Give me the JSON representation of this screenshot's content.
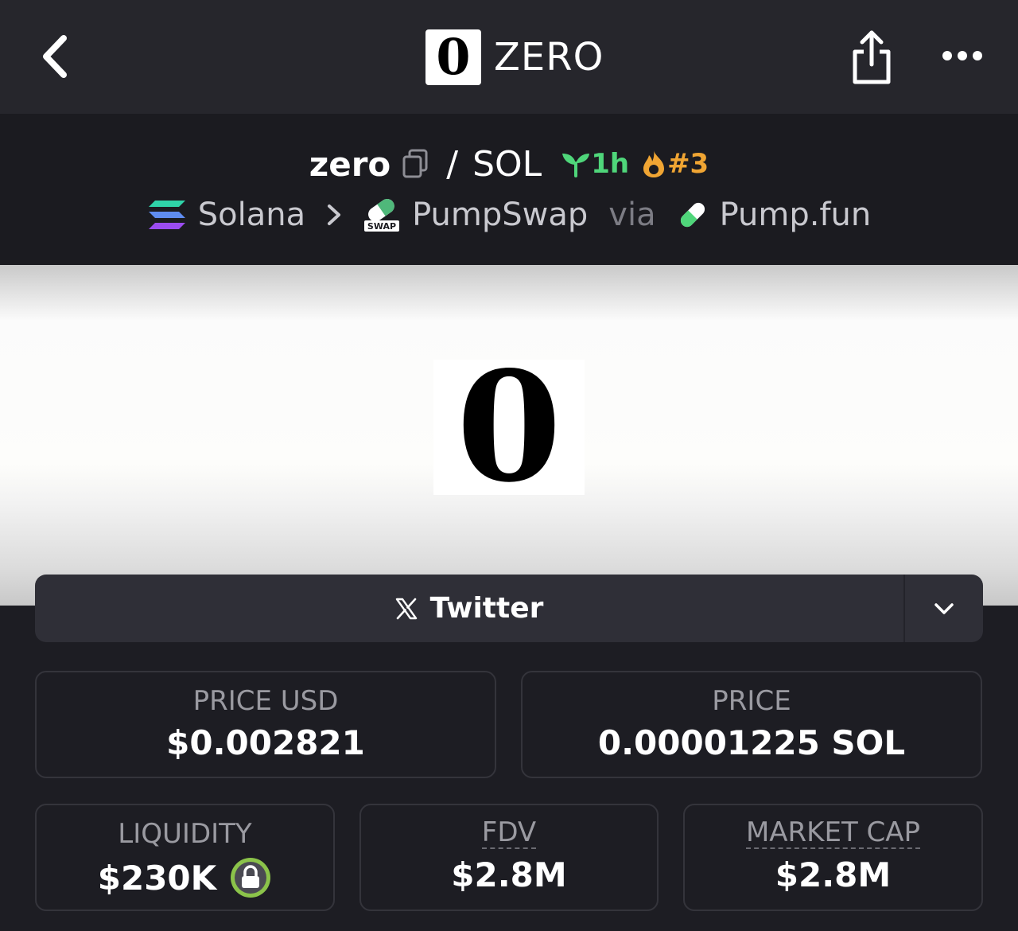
{
  "nav": {
    "logo_glyph": "0",
    "title": "ZERO"
  },
  "pair": {
    "base": "zero",
    "separator": "/",
    "quote": "SOL",
    "age": "1h",
    "rank": "#3"
  },
  "route": {
    "chain": "Solana",
    "dex": "PumpSwap",
    "via": "via",
    "launchpad": "Pump.fun",
    "dex_badge": "SWAP"
  },
  "banner": {
    "logo_glyph": "0"
  },
  "social": {
    "twitter_label": "Twitter"
  },
  "stats": {
    "price_usd": {
      "label": "PRICE USD",
      "value": "$0.002821"
    },
    "price_native": {
      "label": "PRICE",
      "value": "0.00001225 SOL"
    },
    "liquidity": {
      "label": "LIQUIDITY",
      "value": "$230K"
    },
    "fdv": {
      "label": "FDV",
      "value": "$2.8M"
    },
    "market_cap": {
      "label": "MARKET CAP",
      "value": "$2.8M"
    }
  },
  "colors": {
    "age_green": "#4fd67a",
    "rank_orange": "#f0a533",
    "lock_green": "#8bc34a"
  },
  "icons": [
    "back-icon",
    "share-icon",
    "more-icon",
    "copy-icon",
    "sprout-icon",
    "flame-icon",
    "solana-icon",
    "chevron-right-icon",
    "pumpswap-icon",
    "pill-icon",
    "x-icon",
    "chevron-down-icon",
    "lock-icon"
  ]
}
